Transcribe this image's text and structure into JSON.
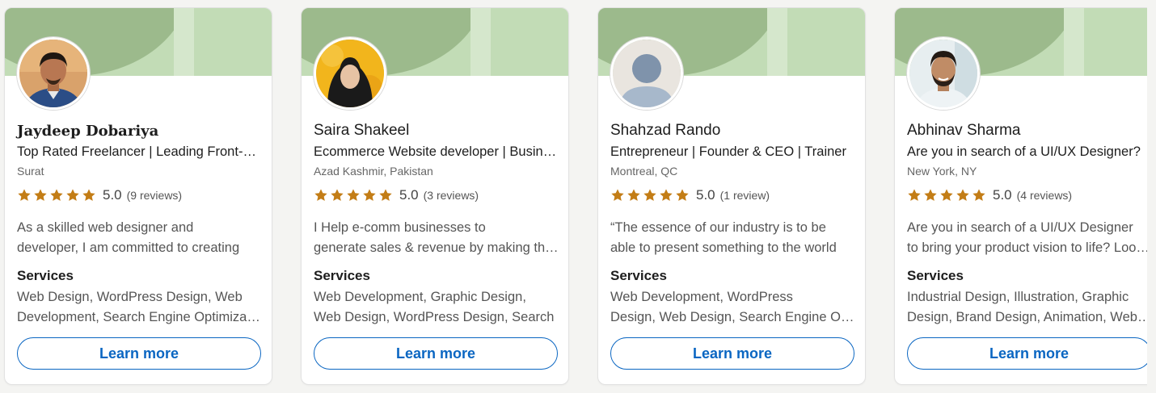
{
  "colors": {
    "banner_dark": "#9cba8c",
    "banner_light": "#c2dcb6",
    "star": "#c37d16",
    "button": "#0a66c2"
  },
  "cards": [
    {
      "name": "Jaydeep Dobariya",
      "headline": "Top Rated Freelancer | Leading Front-End Developer",
      "location": "Surat",
      "rating": "5.0",
      "reviews": "(9 reviews)",
      "stars": 5,
      "summary": [
        "As a skilled web designer and",
        "developer, I am committed to creating"
      ],
      "services_title": "Services",
      "services": [
        "Web Design, WordPress Design, Web",
        "Development, Search Engine Optimization"
      ],
      "button": "Learn more",
      "avatar_icon": "profile-photo-jaydeep"
    },
    {
      "name": "Saira Shakeel",
      "headline": "Ecommerce Website developer | Business Growth",
      "location": "Azad Kashmir, Pakistan",
      "rating": "5.0",
      "reviews": "(3 reviews)",
      "stars": 5,
      "summary": [
        "I Help e-comm businesses to",
        "generate sales & revenue by making them"
      ],
      "services_title": "Services",
      "services": [
        "Web Development, Graphic Design,",
        "Web Design, WordPress Design, Search"
      ],
      "button": "Learn more",
      "avatar_icon": "profile-photo-saira"
    },
    {
      "name": "Shahzad Rando",
      "headline": "Entrepreneur | Founder & CEO | Trainer",
      "location": "Montreal, QC",
      "rating": "5.0",
      "reviews": "(1 review)",
      "stars": 5,
      "summary": [
        "“The essence of our industry is to be",
        "able to present something to the world"
      ],
      "services_title": "Services",
      "services": [
        "Web Development, WordPress",
        "Design, Web Design, Search Engine Optimization"
      ],
      "button": "Learn more",
      "avatar_icon": "default-avatar-icon"
    },
    {
      "name": "Abhinav Sharma",
      "headline": "Are you in search of a UI/UX Designer?",
      "location": "New York, NY",
      "rating": "5.0",
      "reviews": "(4 reviews)",
      "stars": 5,
      "summary": [
        "Are you in search of a UI/UX Designer",
        "to bring your product vision to life? Look no further"
      ],
      "services_title": "Services",
      "services": [
        "Industrial Design, Illustration, Graphic",
        "Design, Brand Design, Animation, Web Design"
      ],
      "button": "Learn more",
      "avatar_icon": "profile-photo-abhinav"
    }
  ]
}
